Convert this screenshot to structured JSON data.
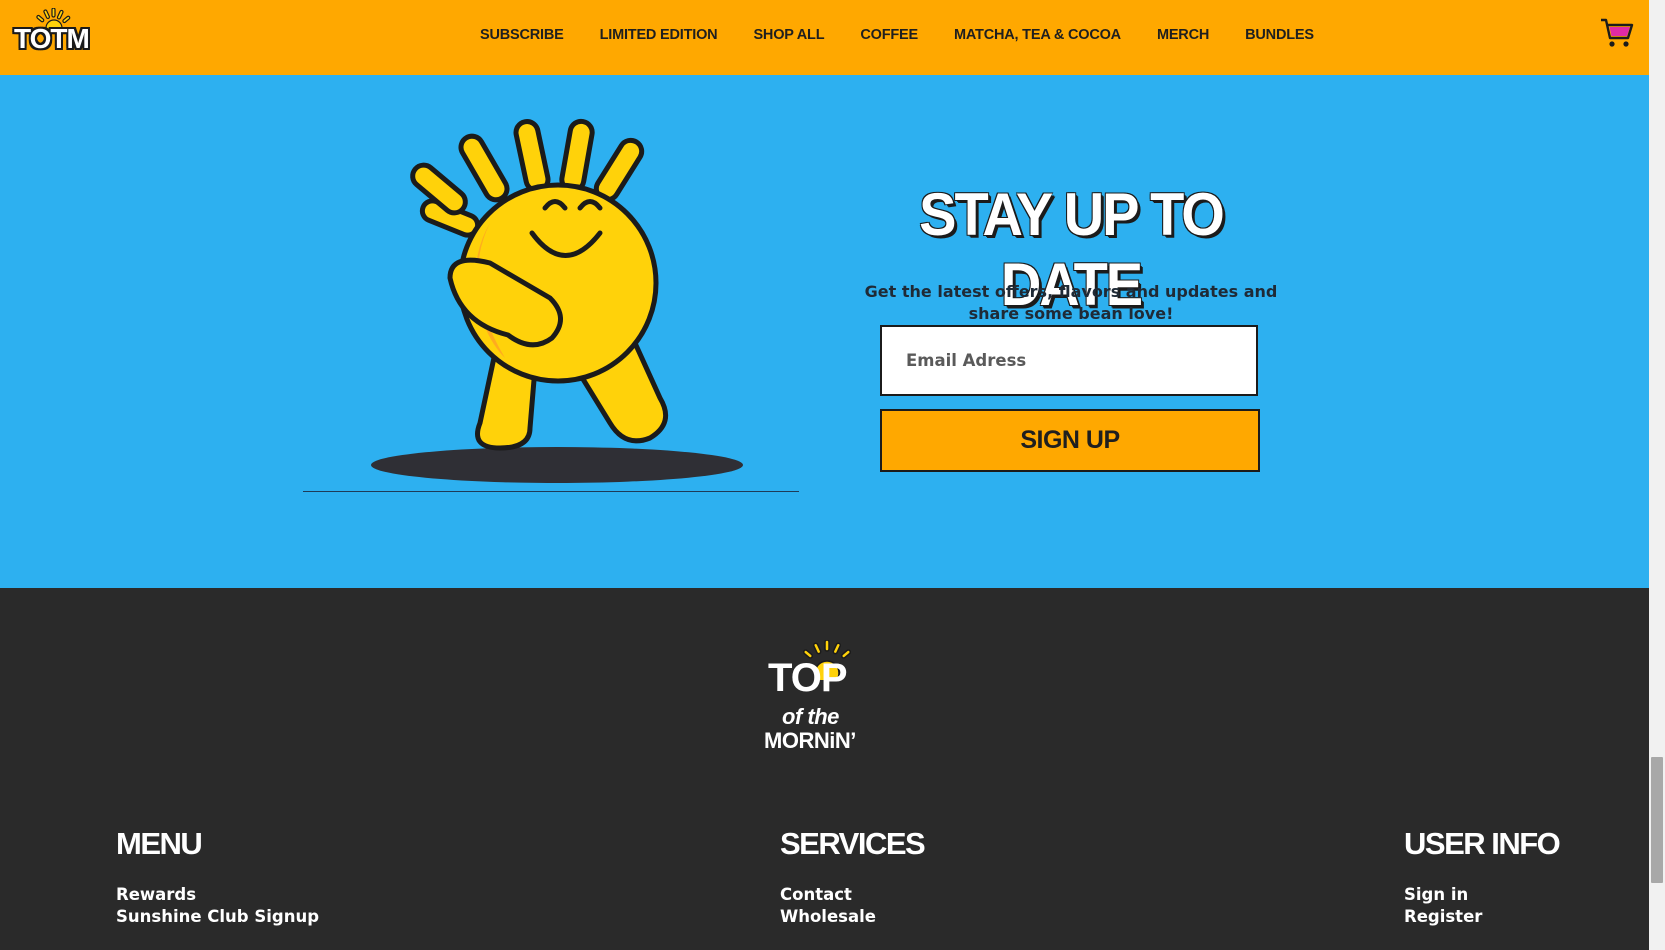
{
  "header": {
    "logo_text": "TOTM",
    "nav": [
      "SUBSCRIBE",
      "LIMITED EDITION",
      "SHOP ALL",
      "COFFEE",
      "MATCHA, TEA & COCOA",
      "MERCH",
      "BUNDLES"
    ],
    "cart_icon": "cart-icon"
  },
  "hero": {
    "title": "STAY UP TO DATE",
    "description": "Get the latest offers, flavors and updates and share some bean love!",
    "email_placeholder": "Email Adress",
    "signup_label": "SIGN UP"
  },
  "footer": {
    "logo": {
      "line1": "TOP",
      "line2": "of the",
      "line3": "MORNiN’"
    },
    "menu": {
      "heading": "MENU",
      "links": [
        "Rewards",
        "Sunshine Club Signup"
      ]
    },
    "services": {
      "heading": "SERVICES",
      "links": [
        "Contact",
        "Wholesale"
      ]
    },
    "user_info": {
      "heading": "USER INFO",
      "links": [
        "Sign in",
        "Register"
      ]
    }
  },
  "colors": {
    "brand_orange": "#ffa800",
    "sky_blue": "#2db0f0",
    "footer_dark": "#2a2a2a",
    "sun_yellow": "#ffd20a",
    "cart_pink": "#e02aa6"
  }
}
